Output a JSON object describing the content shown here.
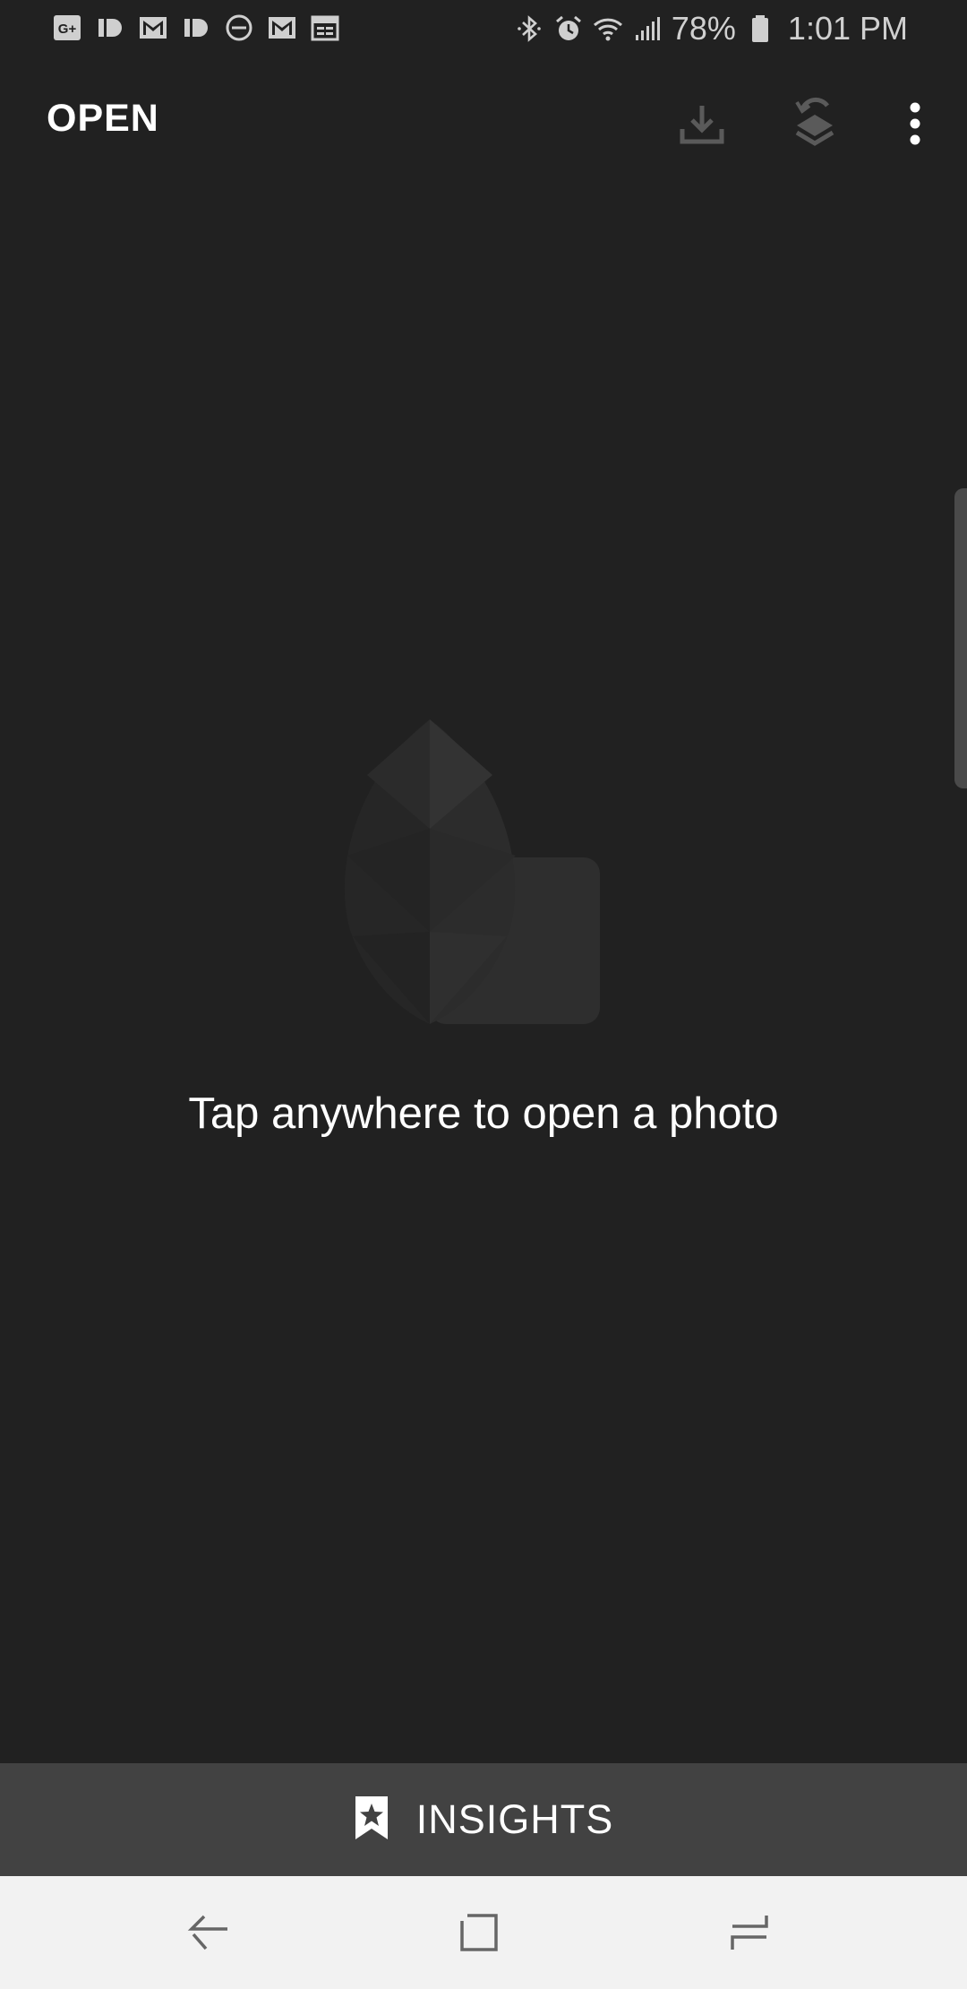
{
  "status_bar": {
    "notification_icons": [
      "google-plus-icon",
      "pushbullet-icon",
      "gmail-icon",
      "pushbullet-icon",
      "do-not-disturb-icon",
      "gmail-icon",
      "calendar-icon"
    ],
    "system_icons": [
      "bluetooth-icon",
      "alarm-icon",
      "wifi-icon",
      "signal-icon"
    ],
    "battery_percent": "78%",
    "battery_level": 0.78,
    "time": "1:01 PM"
  },
  "app_bar": {
    "open_label": "OPEN",
    "actions": [
      "download-icon",
      "layers-undo-icon",
      "more-vert-icon"
    ]
  },
  "main": {
    "illustration": "snapseed-leaf-logo",
    "empty_message": "Tap anywhere to open a photo"
  },
  "insights": {
    "icon": "bookmark-star-icon",
    "label": "INSIGHTS"
  },
  "nav_bar": {
    "buttons": [
      "back-icon",
      "home-icon",
      "recents-icon"
    ]
  },
  "colors": {
    "background": "#212121",
    "insights_bar": "#424242",
    "nav_bar": "#f2f2f2",
    "text": "#ffffff",
    "status_text": "#d0d0d0"
  }
}
